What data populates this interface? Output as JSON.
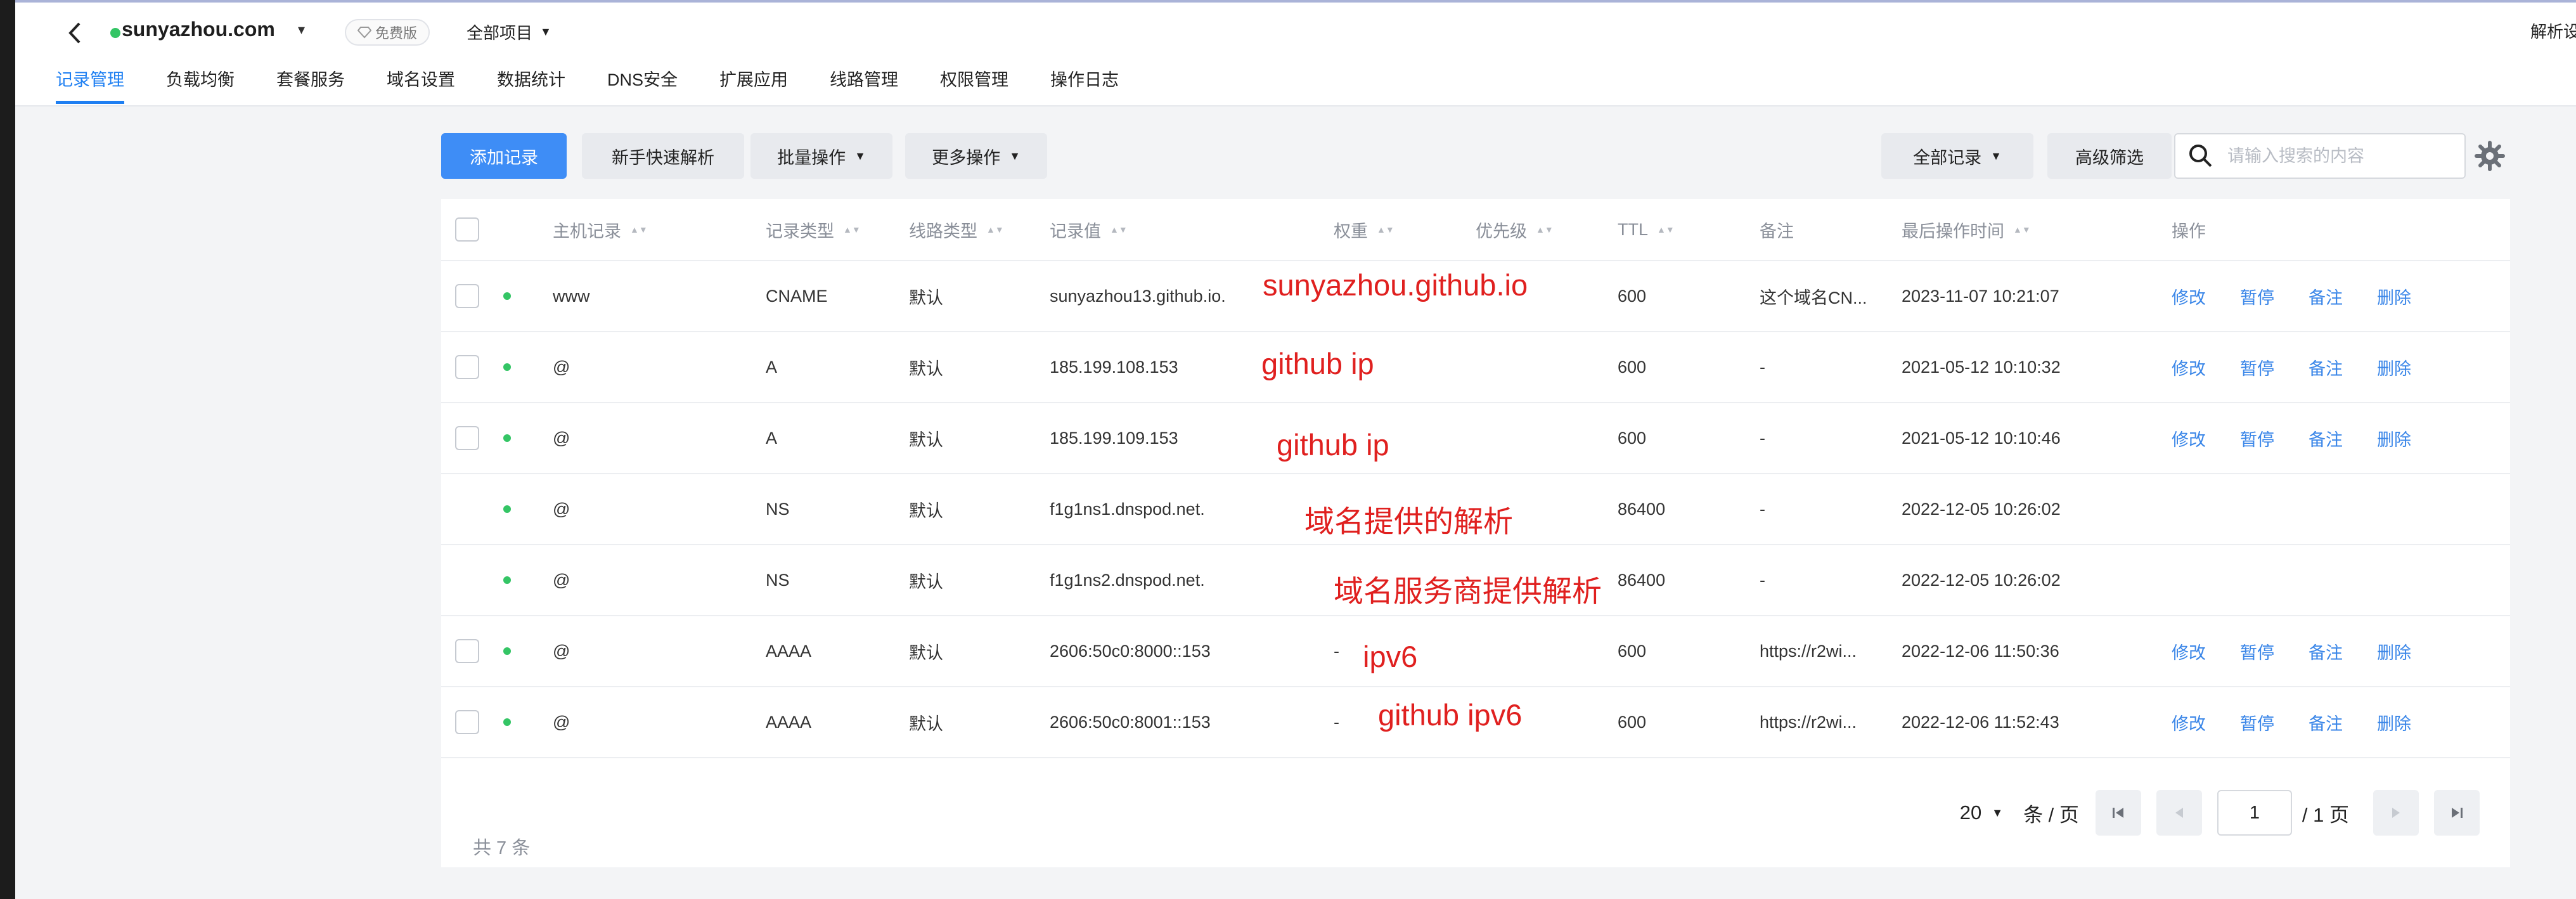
{
  "header": {
    "domain": "sunyazhou.com",
    "badge": "免费版",
    "project": "全部项目",
    "right_label": "解析设置"
  },
  "tabs": [
    "记录管理",
    "负载均衡",
    "套餐服务",
    "域名设置",
    "数据统计",
    "DNS安全",
    "扩展应用",
    "线路管理",
    "权限管理",
    "操作日志"
  ],
  "toolbar": {
    "add": "添加记录",
    "quick": "新手快速解析",
    "batch": "批量操作",
    "more": "更多操作",
    "all_records": "全部记录",
    "advanced": "高级筛选",
    "search_placeholder": "请输入搜索的内容"
  },
  "table": {
    "columns": {
      "host": "主机记录",
      "type": "记录类型",
      "line": "线路类型",
      "value": "记录值",
      "weight": "权重",
      "priority": "优先级",
      "ttl": "TTL",
      "remark": "备注",
      "time": "最后操作时间",
      "ops": "操作"
    },
    "rows": [
      {
        "host": "www",
        "type": "CNAME",
        "line": "默认",
        "value": "sunyazhou13.github.io.",
        "weight": "",
        "ttl": "600",
        "remark": "这个域名CN...",
        "time": "2023-11-07 10:21:07",
        "editable": true
      },
      {
        "host": "@",
        "type": "A",
        "line": "默认",
        "value": "185.199.108.153",
        "weight": "",
        "ttl": "600",
        "remark": "-",
        "time": "2021-05-12 10:10:32",
        "editable": true
      },
      {
        "host": "@",
        "type": "A",
        "line": "默认",
        "value": "185.199.109.153",
        "weight": "",
        "ttl": "600",
        "remark": "-",
        "time": "2021-05-12 10:10:46",
        "editable": true
      },
      {
        "host": "@",
        "type": "NS",
        "line": "默认",
        "value": "f1g1ns1.dnspod.net.",
        "weight": "",
        "ttl": "86400",
        "remark": "-",
        "time": "2022-12-05 10:26:02",
        "editable": false
      },
      {
        "host": "@",
        "type": "NS",
        "line": "默认",
        "value": "f1g1ns2.dnspod.net.",
        "weight": "",
        "ttl": "86400",
        "remark": "-",
        "time": "2022-12-05 10:26:02",
        "editable": false
      },
      {
        "host": "@",
        "type": "AAAA",
        "line": "默认",
        "value": "2606:50c0:8000::153",
        "weight": "-",
        "ttl": "600",
        "remark": "https://r2wi...",
        "time": "2022-12-06 11:50:36",
        "editable": true
      },
      {
        "host": "@",
        "type": "AAAA",
        "line": "默认",
        "value": "2606:50c0:8001::153",
        "weight": "-",
        "ttl": "600",
        "remark": "https://r2wi...",
        "time": "2022-12-06 11:52:43",
        "editable": true
      }
    ],
    "ops": [
      "修改",
      "暂停",
      "备注",
      "删除"
    ]
  },
  "annotations": [
    "sunyazhou.github.io",
    "github ip",
    "github ip",
    "域名提供的解析",
    "域名服务商提供解析",
    "ipv6",
    "github ipv6"
  ],
  "footer": {
    "total": "共 7 条",
    "page_size": "20",
    "per_page": "条 / 页",
    "current_page": "1",
    "total_pages": "/ 1 页"
  },
  "colors": {
    "accent": "#1e7ff2",
    "primary_button": "#3e8df6",
    "status_dot": "#34c565",
    "annotation": "#e0201f"
  }
}
